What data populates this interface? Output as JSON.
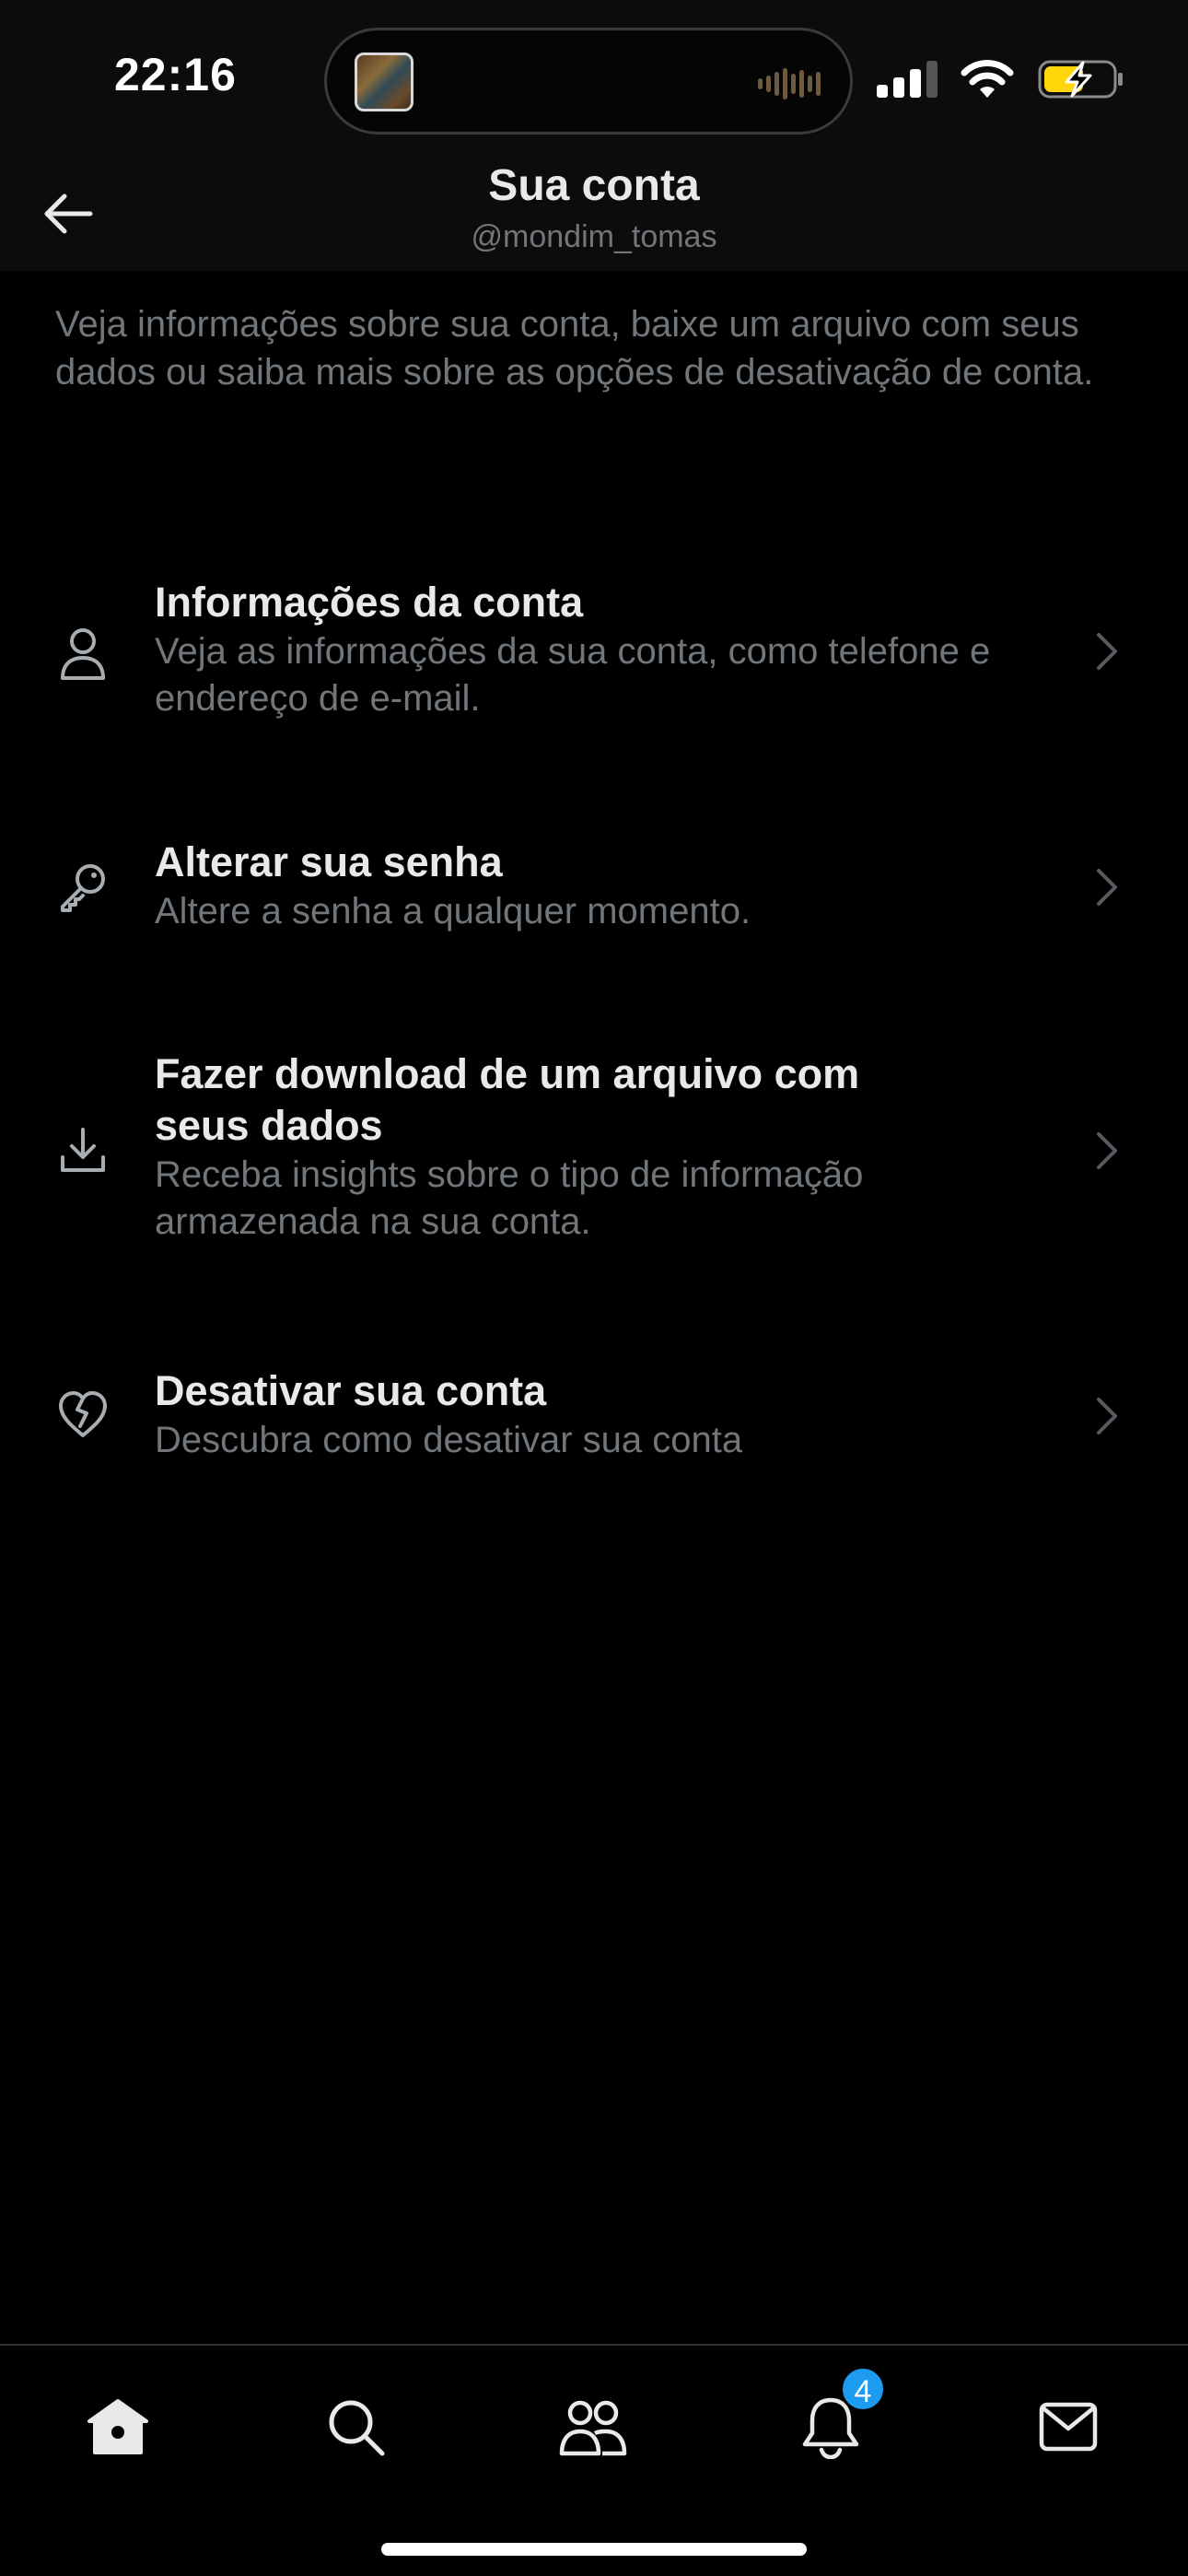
{
  "status_bar": {
    "time": "22:16",
    "icons": [
      "live-activity-thumbnail",
      "audio-waveform-icon",
      "signal-icon",
      "wifi-icon",
      "battery-charging-icon"
    ]
  },
  "header": {
    "back_icon": "arrow-left-icon",
    "title": "Sua conta",
    "subtitle": "@mondim_tomas"
  },
  "intro": "Veja informações sobre sua conta, baixe um arquivo com seus dados ou saiba mais sobre as opções de desativação de conta.",
  "menu": [
    {
      "icon": "person-icon",
      "title": "Informações da conta",
      "description": "Veja as informações da sua conta, como telefone e endereço de e-mail."
    },
    {
      "icon": "key-icon",
      "title": "Alterar sua senha",
      "description": "Altere a senha a qualquer momento."
    },
    {
      "icon": "download-icon",
      "title": "Fazer download de um arquivo com seus dados",
      "description": "Receba insights sobre o tipo de informação armazenada na sua conta."
    },
    {
      "icon": "broken-heart-icon",
      "title": "Desativar sua conta",
      "description": "Descubra como desativar sua conta"
    }
  ],
  "tab_bar": {
    "tabs": [
      "home-icon",
      "search-icon",
      "communities-icon",
      "notifications-icon",
      "messages-icon"
    ],
    "notifications_badge": "4",
    "badge_color": "#1d9bf0"
  },
  "colors": {
    "background": "#000000",
    "primary_text": "#e7e9ea",
    "secondary_text": "#71767b",
    "battery_charging": "#ffd60a"
  }
}
